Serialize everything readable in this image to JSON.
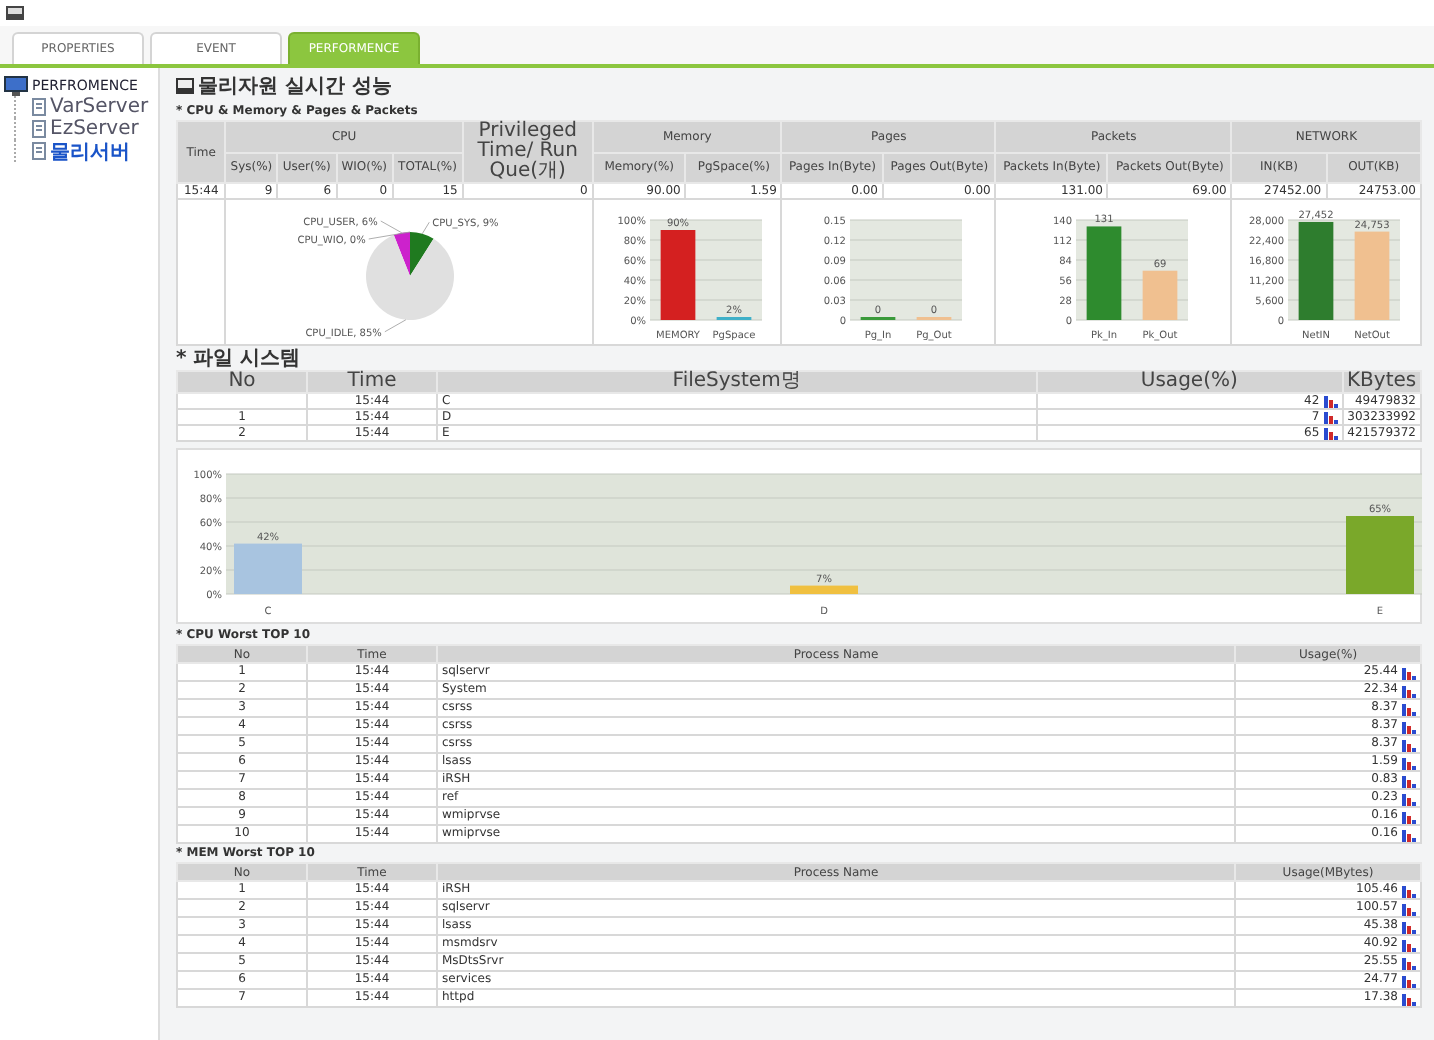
{
  "tabs": [
    {
      "label": "PROPERTIES",
      "selected": false
    },
    {
      "label": "EVENT",
      "selected": false
    },
    {
      "label": "PERFORMENCE",
      "selected": true
    }
  ],
  "sidebar": {
    "root": "PERFROMENCE",
    "items": [
      {
        "label": "VarServer",
        "selected": false
      },
      {
        "label": "EzServer",
        "selected": false
      },
      {
        "label": "물리서버",
        "selected": true
      }
    ]
  },
  "page_title": "물리자원 실시간 성능",
  "summary": {
    "title": "* CPU & Memory & Pages & Packets",
    "groups": [
      {
        "label": "Time"
      },
      {
        "label": "CPU",
        "columns": [
          "Sys(%)",
          "User(%)",
          "WIO(%)",
          "TOTAL(%)"
        ]
      },
      {
        "label": "Privileged Time/ Run Que(개)"
      },
      {
        "label": "Memory",
        "columns": [
          "Memory(%)",
          "PgSpace(%)"
        ]
      },
      {
        "label": "Pages",
        "columns": [
          "Pages In(Byte)",
          "Pages Out(Byte)"
        ]
      },
      {
        "label": "Packets",
        "columns": [
          "Packets In(Byte)",
          "Packets Out(Byte)"
        ]
      },
      {
        "label": "NETWORK",
        "columns": [
          "IN(KB)",
          "OUT(KB)"
        ]
      }
    ],
    "row": [
      "15:44",
      "9",
      "6",
      "0",
      "15",
      "0",
      "90.00",
      "1.59",
      "0.00",
      "0.00",
      "131.00",
      "69.00",
      "27452.00",
      "24753.00"
    ],
    "charts": [
      {
        "chart_data": {
          "type": "pie",
          "categories": [
            "CPU_USER",
            "CPU_WIO",
            "CPU_SYS",
            "CPU_IDLE"
          ],
          "values": [
            6,
            0,
            9,
            85
          ],
          "colors": [
            "#cc22cc",
            null,
            "#1f7a1f",
            "#e0e0e0"
          ],
          "value_labels": [
            "6%",
            "0%",
            "9%",
            "85%"
          ]
        }
      },
      {
        "chart_data": {
          "type": "bar",
          "categories": [
            "MEMORY",
            "PgSpace"
          ],
          "values": [
            90,
            2
          ],
          "colors": [
            "#d42020",
            "#3fb0c8"
          ],
          "ylim": [
            0,
            100
          ],
          "yticks": [
            {
              "value": 0,
              "label": "0%"
            },
            {
              "value": 20,
              "label": "20%"
            },
            {
              "value": 40,
              "label": "40%"
            },
            {
              "value": 60,
              "label": "60%"
            },
            {
              "value": 80,
              "label": "80%"
            },
            {
              "value": 100,
              "label": "100%"
            }
          ],
          "grid": true,
          "value_labels": [
            "90%",
            "2%"
          ]
        }
      },
      {
        "chart_data": {
          "type": "bar",
          "categories": [
            "Pg_In",
            "Pg_Out"
          ],
          "values": [
            0,
            0
          ],
          "colors": [
            "#3a9a3a",
            "#f0c090"
          ],
          "ylim": [
            0,
            0.15
          ],
          "yticks": [
            0,
            0.03,
            0.06,
            0.09,
            0.12,
            0.15
          ],
          "grid": true,
          "value_labels": [
            "0",
            "0"
          ]
        }
      },
      {
        "chart_data": {
          "type": "bar",
          "categories": [
            "Pk_In",
            "Pk_Out"
          ],
          "values": [
            131,
            69
          ],
          "colors": [
            "#2e8b2e",
            "#f0c090"
          ],
          "ylim": [
            0,
            140
          ],
          "yticks": [
            0,
            28,
            56,
            84,
            112,
            140
          ],
          "grid": true,
          "value_labels": [
            "131",
            "69"
          ]
        }
      },
      {
        "chart_data": {
          "type": "bar",
          "categories": [
            "NetIN",
            "NetOut"
          ],
          "values": [
            27452,
            24753
          ],
          "colors": [
            "#2e7d2e",
            "#f0c090"
          ],
          "ylim": [
            0,
            28000
          ],
          "yticks": [
            {
              "value": 0,
              "label": "0"
            },
            {
              "value": 5600,
              "label": "5,600"
            },
            {
              "value": 11200,
              "label": "11,200"
            },
            {
              "value": 16800,
              "label": "16,800"
            },
            {
              "value": 22400,
              "label": "22,400"
            },
            {
              "value": 28000,
              "label": "28,000"
            }
          ],
          "grid": true,
          "value_labels": [
            "27,452",
            "24,753"
          ]
        }
      }
    ]
  },
  "filesystem": {
    "title": "* 파일 시스템",
    "columns": [
      "No",
      "Time",
      "FileSystem명",
      "Usage(%)",
      "KBytes"
    ],
    "rows": [
      [
        "",
        "15:44",
        "C",
        "42",
        "49479832"
      ],
      [
        "1",
        "15:44",
        "D",
        "7",
        "303233992"
      ],
      [
        "2",
        "15:44",
        "E",
        "65",
        "421579372"
      ]
    ],
    "chart_data": {
      "type": "bar",
      "categories": [
        "C",
        "D",
        "E"
      ],
      "values": [
        42,
        7,
        65
      ],
      "colors": [
        "#a8c4e0",
        "#f0c040",
        "#7aa82a"
      ],
      "ylim": [
        0,
        100
      ],
      "yticks": [
        {
          "value": 0,
          "label": "0%"
        },
        {
          "value": 20,
          "label": "20%"
        },
        {
          "value": 40,
          "label": "40%"
        },
        {
          "value": 60,
          "label": "60%"
        },
        {
          "value": 80,
          "label": "80%"
        },
        {
          "value": 100,
          "label": "100%"
        }
      ],
      "grid": true,
      "value_labels": [
        "42%",
        "7%",
        "65%"
      ]
    }
  },
  "cpu_worst": {
    "title": "* CPU Worst TOP 10",
    "columns": [
      "No",
      "Time",
      "Process Name",
      "Usage(%)"
    ],
    "rows": [
      [
        "1",
        "15:44",
        "sqlservr",
        "25.44"
      ],
      [
        "2",
        "15:44",
        "System",
        "22.34"
      ],
      [
        "3",
        "15:44",
        "csrss",
        "8.37"
      ],
      [
        "4",
        "15:44",
        "csrss",
        "8.37"
      ],
      [
        "5",
        "15:44",
        "csrss",
        "8.37"
      ],
      [
        "6",
        "15:44",
        "lsass",
        "1.59"
      ],
      [
        "7",
        "15:44",
        "iRSH",
        "0.83"
      ],
      [
        "8",
        "15:44",
        "ref",
        "0.23"
      ],
      [
        "9",
        "15:44",
        "wmiprvse",
        "0.16"
      ],
      [
        "10",
        "15:44",
        "wmiprvse",
        "0.16"
      ]
    ]
  },
  "mem_worst": {
    "title": "* MEM Worst TOP 10",
    "columns": [
      "No",
      "Time",
      "Process Name",
      "Usage(MBytes)"
    ],
    "rows": [
      [
        "1",
        "15:44",
        "iRSH",
        "105.46"
      ],
      [
        "2",
        "15:44",
        "sqlservr",
        "100.57"
      ],
      [
        "3",
        "15:44",
        "lsass",
        "45.38"
      ],
      [
        "4",
        "15:44",
        "msmdsrv",
        "40.92"
      ],
      [
        "5",
        "15:44",
        "MsDtsSrvr",
        "25.55"
      ],
      [
        "6",
        "15:44",
        "services",
        "24.77"
      ],
      [
        "7",
        "15:44",
        "httpd",
        "17.38"
      ]
    ]
  }
}
